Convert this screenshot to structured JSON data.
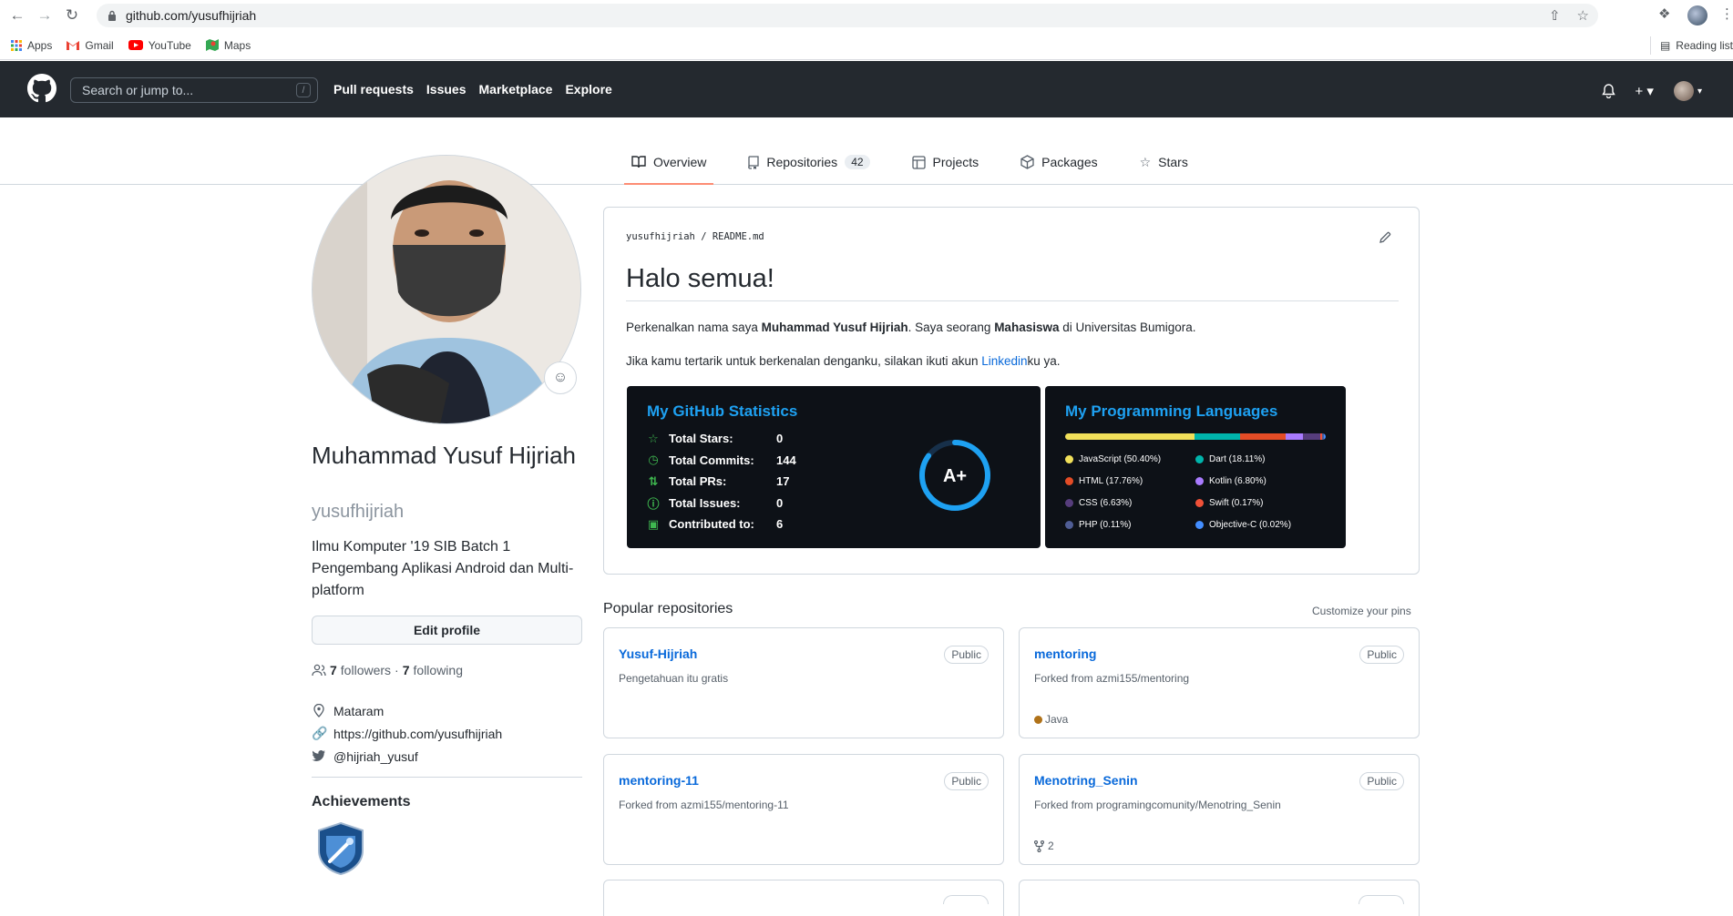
{
  "browser": {
    "url": "github.com/yusufhijriah",
    "bookmarks": [
      "Apps",
      "Gmail",
      "YouTube",
      "Maps"
    ],
    "reading_list": "Reading list"
  },
  "header": {
    "search_placeholder": "Search or jump to...",
    "slash": "/",
    "nav": [
      "Pull requests",
      "Issues",
      "Marketplace",
      "Explore"
    ]
  },
  "tabs": [
    {
      "label": "Overview",
      "icon": "book-icon"
    },
    {
      "label": "Repositories",
      "icon": "repo-icon",
      "count": "42"
    },
    {
      "label": "Projects",
      "icon": "project-icon"
    },
    {
      "label": "Packages",
      "icon": "package-icon"
    },
    {
      "label": "Stars",
      "icon": "star-icon"
    }
  ],
  "profile": {
    "name": "Muhammad Yusuf Hijriah",
    "login": "yusufhijriah",
    "bio": "Ilmu Komputer '19 SIB Batch 1 Pengembang Aplikasi Android dan Multi-platform",
    "edit_label": "Edit profile",
    "followers": "7",
    "followers_label": "followers",
    "sep": "·",
    "following": "7",
    "following_label": "following",
    "location": "Mataram",
    "website": "https://github.com/yusufhijriah",
    "twitter": "@hijriah_yusuf",
    "achievements_title": "Achievements"
  },
  "readme": {
    "owner": "yusufhijriah",
    "slash": "/",
    "file": "README.md",
    "heading": "Halo semua!",
    "p1_a": "Perkenalkan nama saya ",
    "p1_b": "Muhammad Yusuf Hijriah",
    "p1_c": ". Saya seorang ",
    "p1_d": "Mahasiswa",
    "p1_e": " di Universitas Bumigora.",
    "p2_a": "Jika kamu tertarik untuk berkenalan denganku, silakan ikuti akun ",
    "p2_link": "Linkedin",
    "p2_b": "ku ya."
  },
  "stats": {
    "title": "My GitHub Statistics",
    "rows": [
      {
        "label": "Total Stars:",
        "value": "0",
        "icon": "star-icon"
      },
      {
        "label": "Total Commits:",
        "value": "144",
        "icon": "clock-icon"
      },
      {
        "label": "Total PRs:",
        "value": "17",
        "icon": "pr-icon"
      },
      {
        "label": "Total Issues:",
        "value": "0",
        "icon": "issue-icon"
      },
      {
        "label": "Contributed to:",
        "value": "6",
        "icon": "repo-icon"
      }
    ],
    "grade": "A+",
    "grade_progress": 0.85
  },
  "languages": {
    "title": "My Programming Languages",
    "items": [
      {
        "name": "JavaScript (50.40%)",
        "pct": 50.4,
        "color": "#f1e05a"
      },
      {
        "name": "Dart (18.11%)",
        "pct": 18.11,
        "color": "#00b4ab"
      },
      {
        "name": "HTML (17.76%)",
        "pct": 17.76,
        "color": "#e34c26"
      },
      {
        "name": "Kotlin (6.80%)",
        "pct": 6.8,
        "color": "#a97bff"
      },
      {
        "name": "CSS (6.63%)",
        "pct": 6.63,
        "color": "#563d7c"
      },
      {
        "name": "Swift (0.17%)",
        "pct": 0.17,
        "color": "#f05138"
      },
      {
        "name": "PHP (0.11%)",
        "pct": 0.11,
        "color": "#4f5d95"
      },
      {
        "name": "Objective-C (0.02%)",
        "pct": 0.02,
        "color": "#438eff"
      }
    ]
  },
  "popular": {
    "title": "Popular repositories",
    "customize": "Customize your pins",
    "repos": [
      {
        "name": "Yusuf-Hijriah",
        "vis": "Public",
        "desc": "Pengetahuan itu gratis",
        "meta": ""
      },
      {
        "name": "mentoring",
        "vis": "Public",
        "desc": "Forked from azmi155/mentoring",
        "meta": "Java",
        "meta_color": "#b07219"
      },
      {
        "name": "mentoring-11",
        "vis": "Public",
        "desc": "Forked from azmi155/mentoring-11",
        "meta": ""
      },
      {
        "name": "Menotring_Senin",
        "vis": "Public",
        "desc": "Forked from programingcomunity/Menotring_Senin",
        "meta": "2",
        "meta_icon": "fork-icon"
      }
    ]
  }
}
